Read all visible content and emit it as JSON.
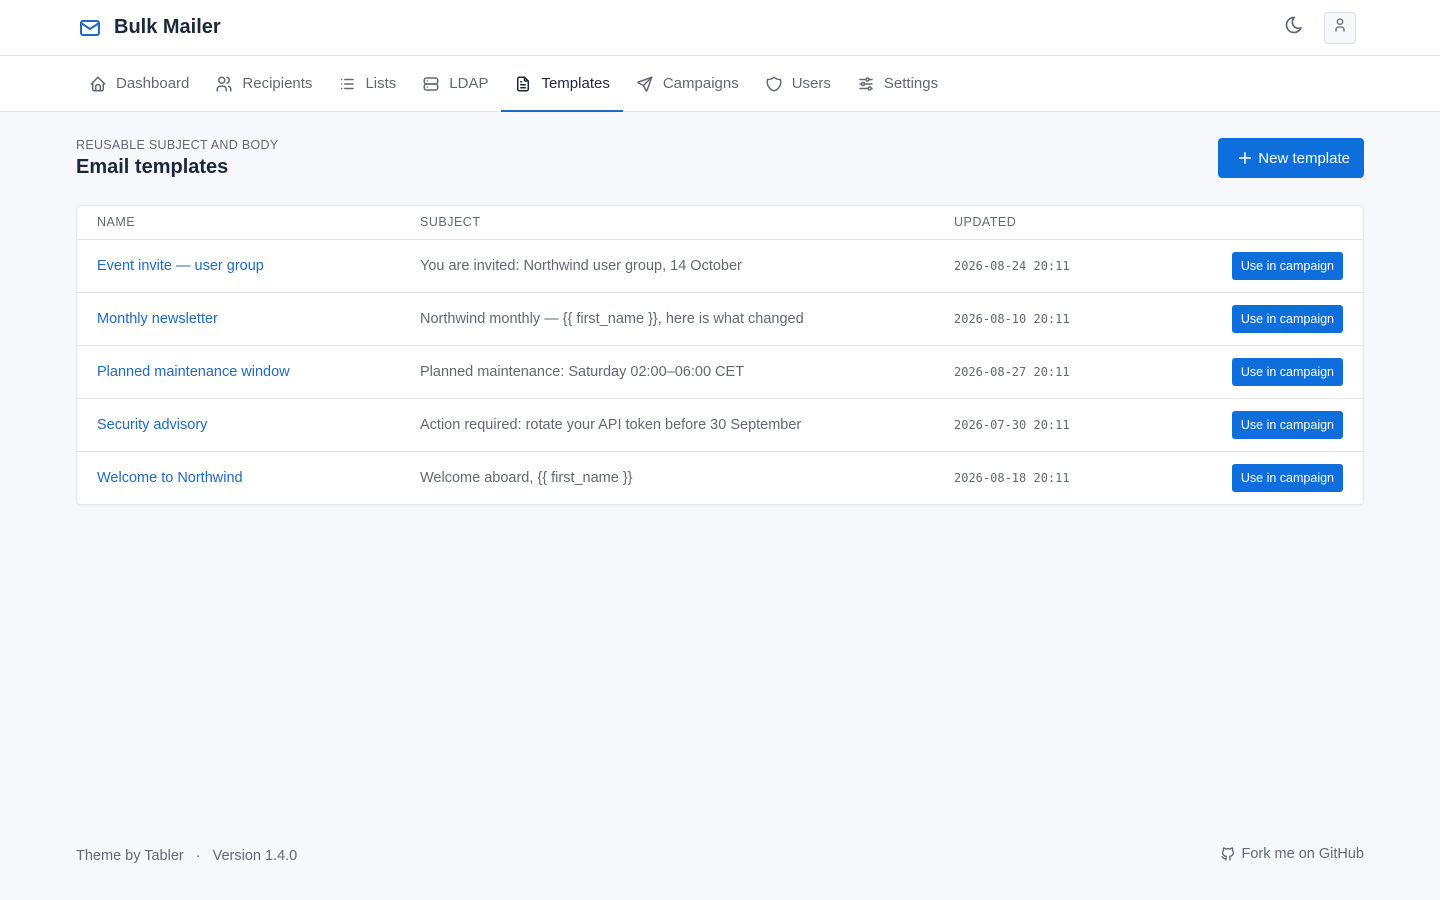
{
  "app": {
    "title": "Bulk Mailer"
  },
  "nav": {
    "items": [
      {
        "label": "Dashboard",
        "icon": "home-icon"
      },
      {
        "label": "Recipients",
        "icon": "users-icon"
      },
      {
        "label": "Lists",
        "icon": "list-icon"
      },
      {
        "label": "LDAP",
        "icon": "server-icon"
      },
      {
        "label": "Templates",
        "icon": "file-text-icon",
        "active": true
      },
      {
        "label": "Campaigns",
        "icon": "send-icon"
      },
      {
        "label": "Users",
        "icon": "shield-icon"
      },
      {
        "label": "Settings",
        "icon": "adjustments-icon"
      }
    ]
  },
  "page": {
    "pretitle": "Reusable subject and body",
    "title": "Email templates",
    "new_button": "New template"
  },
  "table": {
    "headers": {
      "name": "Name",
      "subject": "Subject",
      "updated": "Updated"
    },
    "rows": [
      {
        "name": "Event invite — user group",
        "subject": "You are invited: Northwind user group, 14 October",
        "updated": "2026-08-24 20:11",
        "action": "Use in campaign"
      },
      {
        "name": "Monthly newsletter",
        "subject": "Northwind monthly — {{ first_name }}, here is what changed",
        "updated": "2026-08-10 20:11",
        "action": "Use in campaign"
      },
      {
        "name": "Planned maintenance window",
        "subject": "Planned maintenance: Saturday 02:00–06:00 CET",
        "updated": "2026-08-27 20:11",
        "action": "Use in campaign"
      },
      {
        "name": "Security advisory",
        "subject": "Action required: rotate your API token before 30 September",
        "updated": "2026-07-30 20:11",
        "action": "Use in campaign"
      },
      {
        "name": "Welcome to Northwind",
        "subject": "Welcome aboard, {{ first_name }}",
        "updated": "2026-08-18 20:11",
        "action": "Use in campaign"
      }
    ]
  },
  "footer": {
    "theme": "Theme by Tabler",
    "separator": "·",
    "version": "Version 1.4.0",
    "github": "Fork me on GitHub"
  },
  "colors": {
    "primary": "#0d6edc",
    "link": "#206bc4",
    "muted": "#626976",
    "background": "#f6f8fb"
  }
}
